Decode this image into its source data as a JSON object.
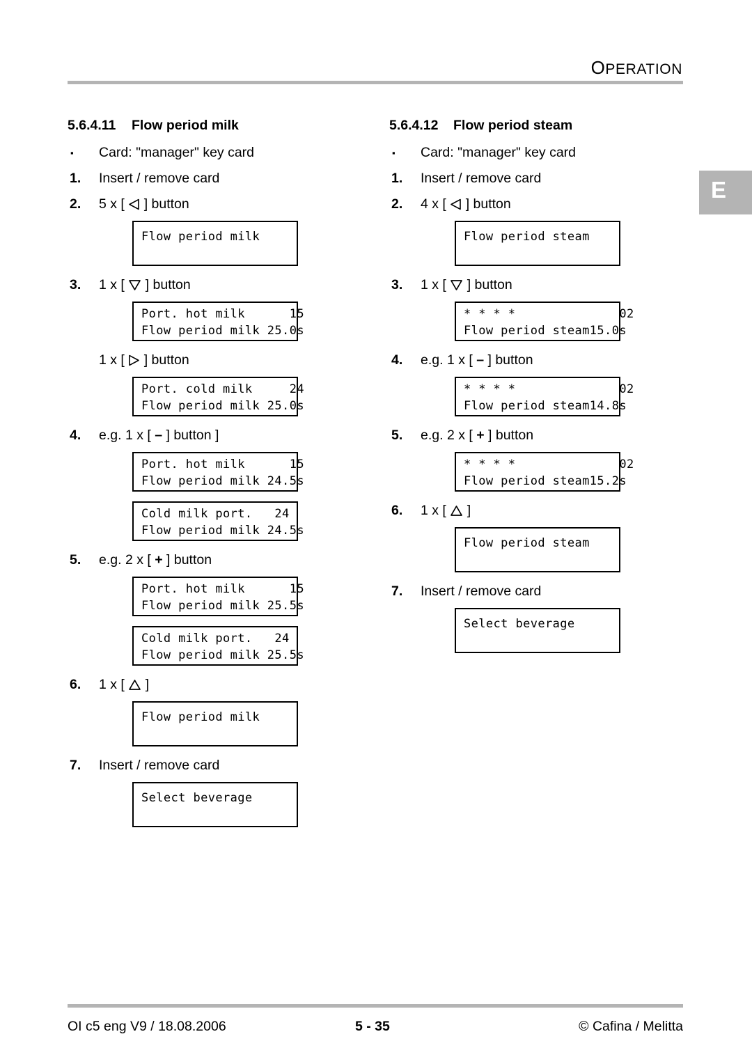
{
  "header": {
    "title_first": "O",
    "title_rest": "PERATION",
    "title_full": "OPERATION"
  },
  "margin_tab": {
    "label": "E"
  },
  "left_column": {
    "heading": {
      "number": "5.6.4.11",
      "title": "Flow period milk"
    },
    "items": [
      {
        "marker": "▪",
        "marker_kind": "bullet",
        "text": "Card: \"manager\" key card"
      },
      {
        "marker": "1.",
        "marker_kind": "number",
        "text": "Insert / remove card"
      },
      {
        "marker": "2.",
        "marker_kind": "number",
        "text_before": "5 x [ ",
        "glyph": "left-triangle",
        "text_after": " ] button"
      },
      {
        "marker": "3.",
        "marker_kind": "number",
        "text_before": "1 x [ ",
        "glyph": "down-triangle",
        "text_after": " ] button"
      },
      {
        "marker": "",
        "marker_kind": "none",
        "text_before": "1 x [ ",
        "glyph": "right-triangle",
        "text_after": " ] button"
      },
      {
        "marker": "4.",
        "marker_kind": "number",
        "text_before": "e.g. 1 x [ ",
        "glyph": "minus",
        "text_after": " ] button ]"
      },
      {
        "marker": "5.",
        "marker_kind": "number",
        "text_before": "e.g. 2 x [ ",
        "glyph": "plus",
        "text_after": " ] button"
      },
      {
        "marker": "6.",
        "marker_kind": "number",
        "text_before": "1 x [ ",
        "glyph": "up-triangle",
        "text_after": " ]"
      },
      {
        "marker": "7.",
        "marker_kind": "number",
        "text": "Insert / remove card"
      }
    ],
    "displays": {
      "d1": {
        "line1": "Flow period milk",
        "line2": ""
      },
      "d2": {
        "line1": "Port. hot milk      15",
        "line2": "Flow period milk 25.0s"
      },
      "d3": {
        "line1": "Port. cold milk     24",
        "line2": "Flow period milk 25.0s"
      },
      "d4": {
        "line1": "Port. hot milk      15",
        "line2": "Flow period milk 24.5s"
      },
      "d5": {
        "line1": "Cold milk port.   24",
        "line2": "Flow period milk 24.5s"
      },
      "d6": {
        "line1": "Port. hot milk      15",
        "line2": "Flow period milk 25.5s"
      },
      "d7": {
        "line1": "Cold milk port.   24",
        "line2": "Flow period milk 25.5s"
      },
      "d8": {
        "line1": "Flow period milk",
        "line2": ""
      },
      "d9": {
        "line1": "Select beverage",
        "line2": ""
      }
    }
  },
  "right_column": {
    "heading": {
      "number": "5.6.4.12",
      "title": "Flow period steam"
    },
    "items": [
      {
        "marker": "▪",
        "marker_kind": "bullet",
        "text": "Card: \"manager\" key card"
      },
      {
        "marker": "1.",
        "marker_kind": "number",
        "text": "Insert / remove card"
      },
      {
        "marker": "2.",
        "marker_kind": "number",
        "text_before": "4 x [ ",
        "glyph": "left-triangle",
        "text_after": " ] button"
      },
      {
        "marker": "3.",
        "marker_kind": "number",
        "text_before": "1 x [ ",
        "glyph": "down-triangle",
        "text_after": " ] button"
      },
      {
        "marker": "4.",
        "marker_kind": "number",
        "text_before": "e.g. 1 x [ ",
        "glyph": "minus",
        "text_after": " ] button"
      },
      {
        "marker": "5.",
        "marker_kind": "number",
        "text_before": "e.g. 2 x [ ",
        "glyph": "plus",
        "text_after": " ] button"
      },
      {
        "marker": "6.",
        "marker_kind": "number",
        "text_before": "1 x [ ",
        "glyph": "up-triangle",
        "text_after": " ]"
      },
      {
        "marker": "7.",
        "marker_kind": "number",
        "text": "Insert / remove card"
      }
    ],
    "displays": {
      "d1": {
        "line1": "Flow period steam",
        "line2": ""
      },
      "d2": {
        "line1": "* * * *              02",
        "line2": "Flow period steam15.0s"
      },
      "d3": {
        "line1": "* * * *              02",
        "line2": "Flow period steam14.8s"
      },
      "d4": {
        "line1": "* * * *              02",
        "line2": "Flow period steam15.2s"
      },
      "d5": {
        "line1": "Flow period steam",
        "line2": ""
      },
      "d6": {
        "line1": "Select beverage",
        "line2": ""
      }
    }
  },
  "footer": {
    "left": "OI c5 eng V9 / 18.08.2006",
    "center": "5 - 35",
    "right": "© Cafina / Melitta"
  }
}
